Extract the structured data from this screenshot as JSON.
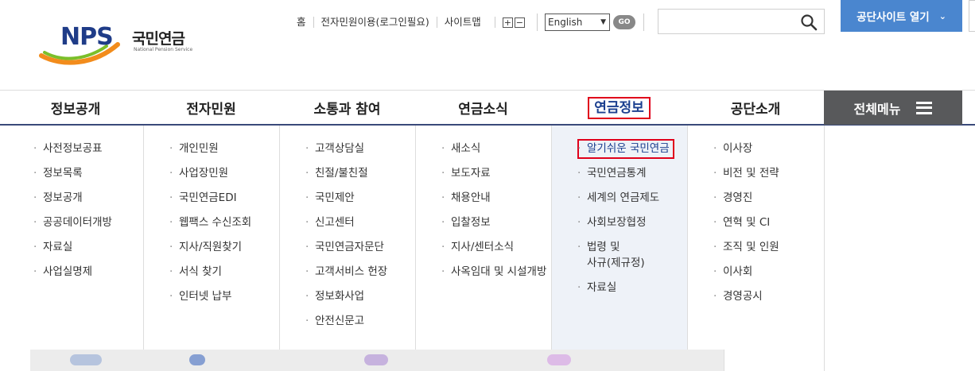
{
  "logo": {
    "mark": "NPS",
    "name_ko": "국민연금",
    "name_en": "National Pension Service"
  },
  "util_links": [
    "홈",
    "전자민원이용(로그인필요)",
    "사이트맵"
  ],
  "zoom": {
    "in": "+",
    "out": "−"
  },
  "language": {
    "selected": "English",
    "go": "GO"
  },
  "search": {
    "placeholder": "",
    "icon": "search-icon"
  },
  "site_button": {
    "label": "공단사이트 열기",
    "icon": "chevron-down-icon"
  },
  "gnb": {
    "items": [
      "정보공개",
      "전자민원",
      "소통과 참여",
      "연금소식",
      "연금정보",
      "공단소개"
    ],
    "active": "연금정보",
    "all_menu": "전체메뉴"
  },
  "submenu": [
    [
      "사전정보공표",
      "정보목록",
      "정보공개",
      "공공데이터개방",
      "자료실",
      "사업실명제"
    ],
    [
      "개인민원",
      "사업장민원",
      "국민연금EDI",
      "웹팩스 수신조회",
      "지사/직원찾기",
      "서식 찾기",
      "인터넷 납부"
    ],
    [
      "고객상담실",
      "친절/불친절",
      "국민제안",
      "신고센터",
      "국민연금자문단",
      "고객서비스 헌장",
      "정보화사업",
      "안전신문고"
    ],
    [
      "새소식",
      "보도자료",
      "채용안내",
      "입찰정보",
      "지사/센터소식",
      "사옥임대 및 시설개방"
    ],
    [
      "알기쉬운 국민연금",
      "국민연금통계",
      "세계의 연금제도",
      "사회보장협정",
      "법령 및",
      "사규(제규정)",
      "자료실"
    ],
    [
      "이사장",
      "비전 및 전략",
      "경영진",
      "연혁 및 CI",
      "조직 및 인원",
      "이사회",
      "경영공시"
    ]
  ],
  "colors": {
    "accent": "#4a86cf",
    "highlight_box": "#e0001b",
    "active_text": "#1b3f8f",
    "allmenu_bg": "#58595b"
  }
}
